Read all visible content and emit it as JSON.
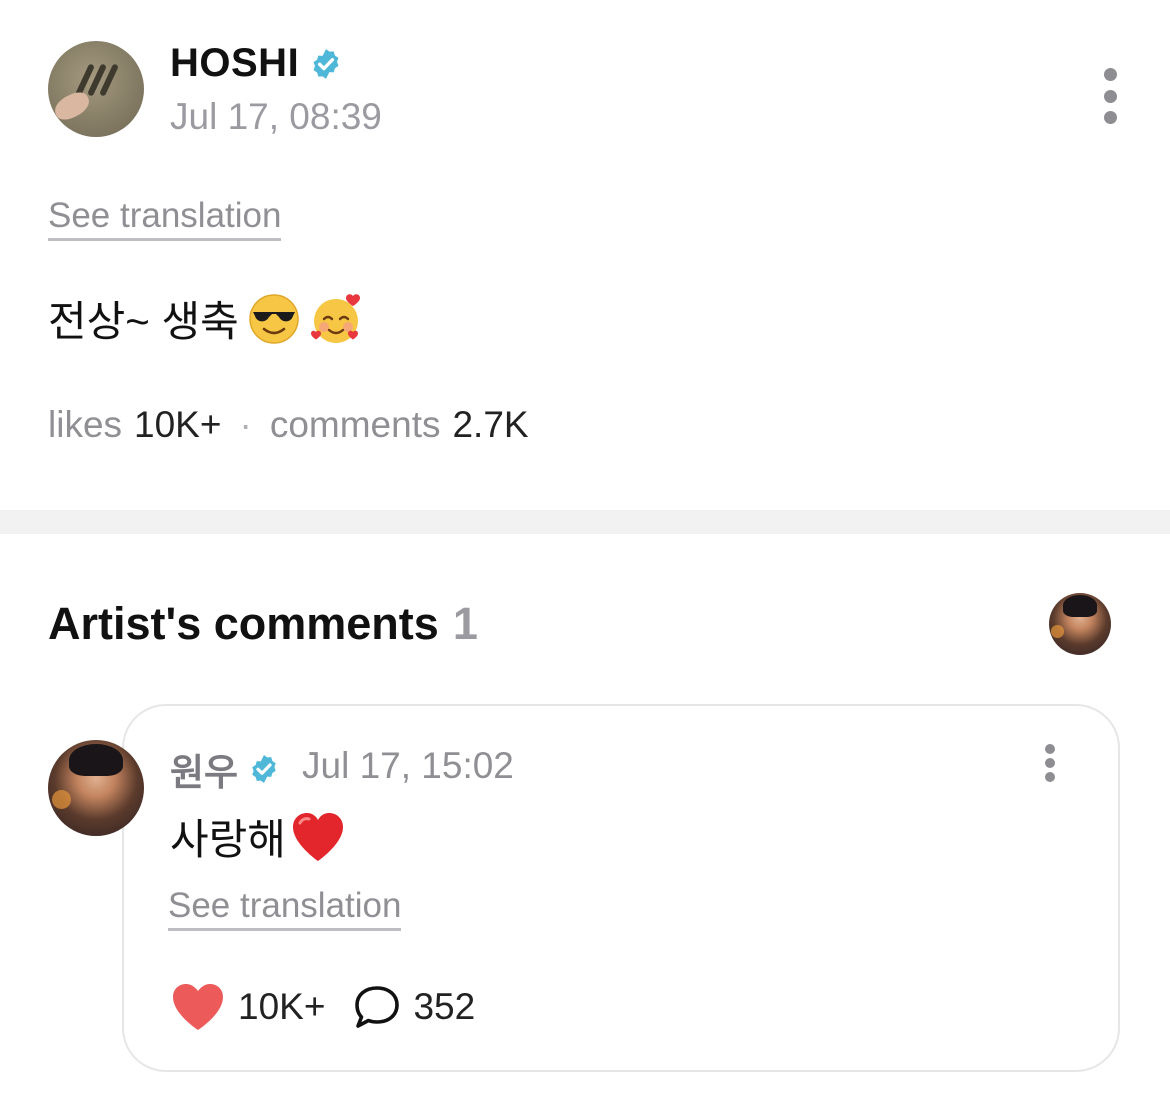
{
  "post": {
    "author_name": "HOSHI",
    "timestamp": "Jul 17, 08:39",
    "see_translation": "See translation",
    "text": "전상~ 생축",
    "emojis": [
      "smiling-face-with-sunglasses",
      "smiling-face-with-hearts"
    ],
    "stats": {
      "likes_label": "likes",
      "likes_value": "10K+",
      "separator": "·",
      "comments_label": "comments",
      "comments_value": "2.7K"
    }
  },
  "artist_comments": {
    "title": "Artist's comments",
    "count": "1",
    "comment": {
      "author_name": "원우",
      "timestamp": "Jul 17, 15:02",
      "text": "사랑해",
      "emoji": "red-heart",
      "see_translation": "See translation",
      "likes": "10K+",
      "replies": "352"
    }
  },
  "colors": {
    "verified": "#4fb8d8",
    "muted_text": "#8f8f94",
    "heart": "#ec5a5a",
    "divider": "#f2f2f3"
  }
}
